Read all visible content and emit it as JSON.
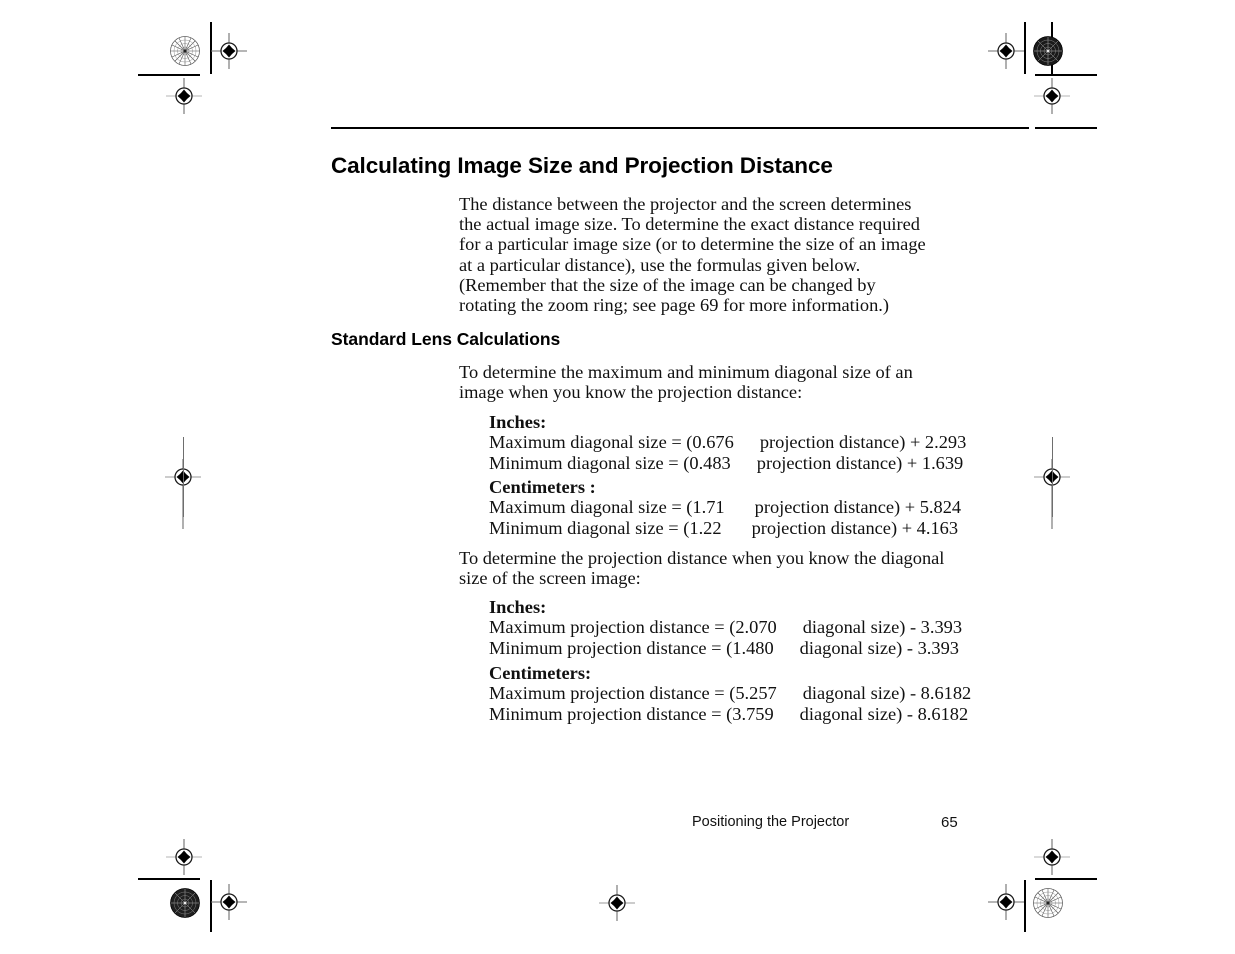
{
  "page": {
    "title": "Calculating Image Size and Projection Distance",
    "section_title": "Standard Lens Calculations",
    "intro_paragraph": "The distance between the projector and the screen determines the actual image size. To determine the exact distance required for a particular image size (or to determine the size of an image at a particular distance), use the formulas given below. (Remember that the size of the image can be changed by rotating the zoom ring; see page 69 for more information.)",
    "lead_in_1": "To determine the maximum and minimum diagonal size of an image when you know the projection distance:",
    "lead_in_2": "To determine the projection distance when you know the diagonal size of the screen image:"
  },
  "diagonal_size_formulas": {
    "inches": {
      "label": "Inches:",
      "rows": [
        {
          "prefix": "Maximum diagonal size = (0.676",
          "suffix": "projection distance) + 2.293"
        },
        {
          "prefix": "Minimum diagonal size = (0.483",
          "suffix": "projection distance) + 1.639"
        }
      ]
    },
    "centimeters": {
      "label": "Centimeters :",
      "rows": [
        {
          "prefix": "Maximum diagonal size = (1.71",
          "suffix": "projection distance) + 5.824"
        },
        {
          "prefix": "Minimum diagonal size = (1.22",
          "suffix": "projection distance) + 4.163"
        }
      ]
    }
  },
  "projection_distance_formulas": {
    "inches": {
      "label": "Inches:",
      "rows": [
        {
          "prefix": "Maximum projection distance = (2.070",
          "suffix": "diagonal size) - 3.393"
        },
        {
          "prefix": "Minimum projection distance = (1.480",
          "suffix": "diagonal size) - 3.393"
        }
      ]
    },
    "centimeters": {
      "label": "Centimeters:",
      "rows": [
        {
          "prefix": "Maximum projection distance = (5.257",
          "suffix": "diagonal size) - 8.6182"
        },
        {
          "prefix": "Minimum projection distance = (3.759",
          "suffix": "diagonal size) - 8.6182"
        }
      ]
    }
  },
  "footer": {
    "running_head": "Positioning the Projector",
    "page_number": "65"
  },
  "colors": {
    "text": "#111111",
    "rule": "#000000",
    "paper": "#ffffff",
    "mark_light": "#8a8a8a"
  }
}
